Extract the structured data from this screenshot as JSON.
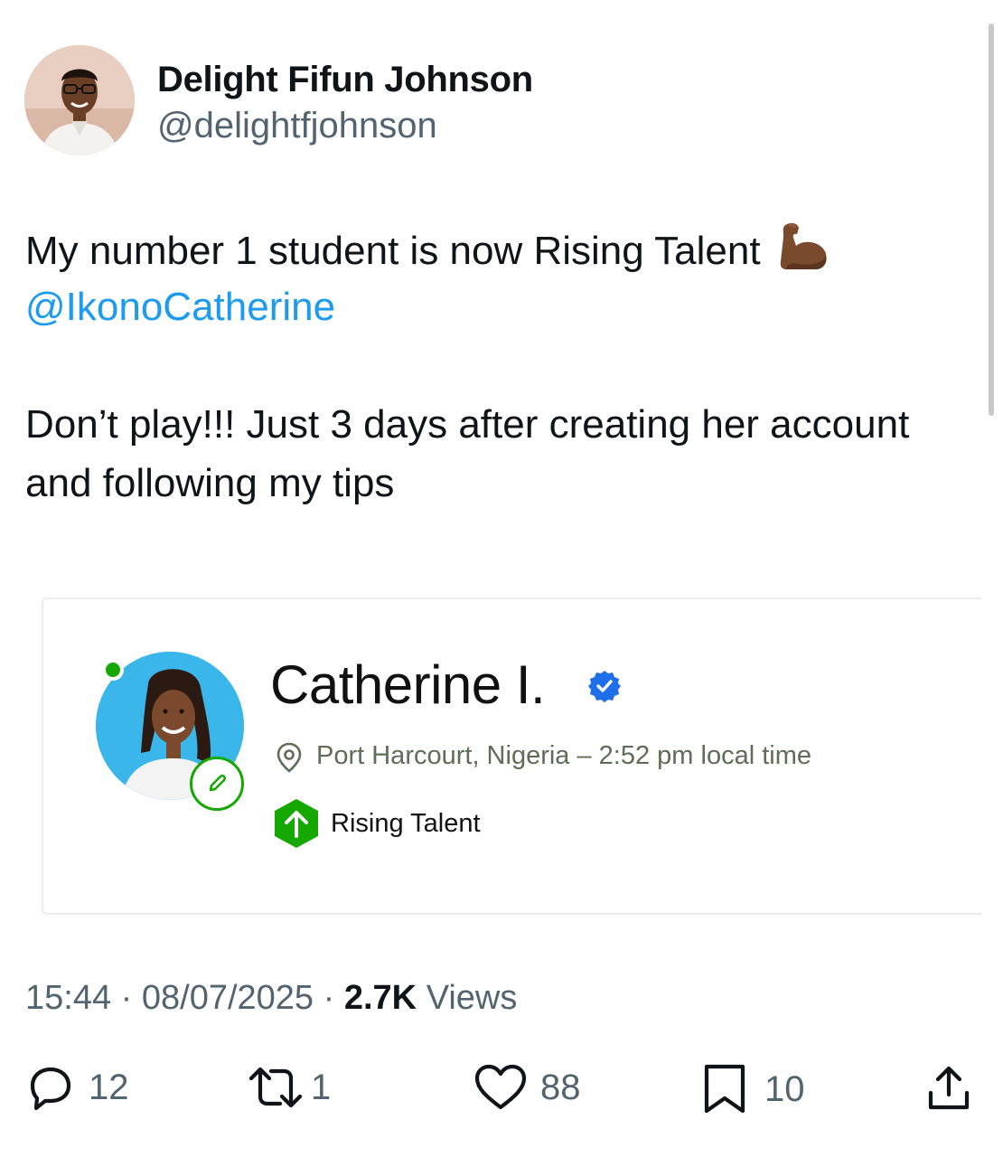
{
  "author": {
    "display_name": "Delight Fifun Johnson",
    "handle": "@delightfjohnson"
  },
  "tweet": {
    "line1": "My number 1 student is now Rising Talent",
    "emoji": "flexed-biceps",
    "mention": "@IkonoCatherine",
    "line3": "Don’t play!!! Just 3 days after creating her account",
    "line4": "and following my tips"
  },
  "embedded_card": {
    "name": "Catherine I.",
    "location": "Port Harcourt, Nigeria – 2:52 pm local time",
    "badge_label": "Rising Talent",
    "online_status": "online"
  },
  "meta": {
    "time": "15:44",
    "separator": "·",
    "date": "08/07/2025",
    "views_count": "2.7K",
    "views_label": "Views"
  },
  "actions": {
    "replies": "12",
    "reposts": "1",
    "likes": "88",
    "bookmarks": "10"
  },
  "colors": {
    "text": "#0f1419",
    "secondary": "#536471",
    "link": "#1d9bf0",
    "upwork_green": "#14a800",
    "verified_blue": "#1f6feb"
  }
}
